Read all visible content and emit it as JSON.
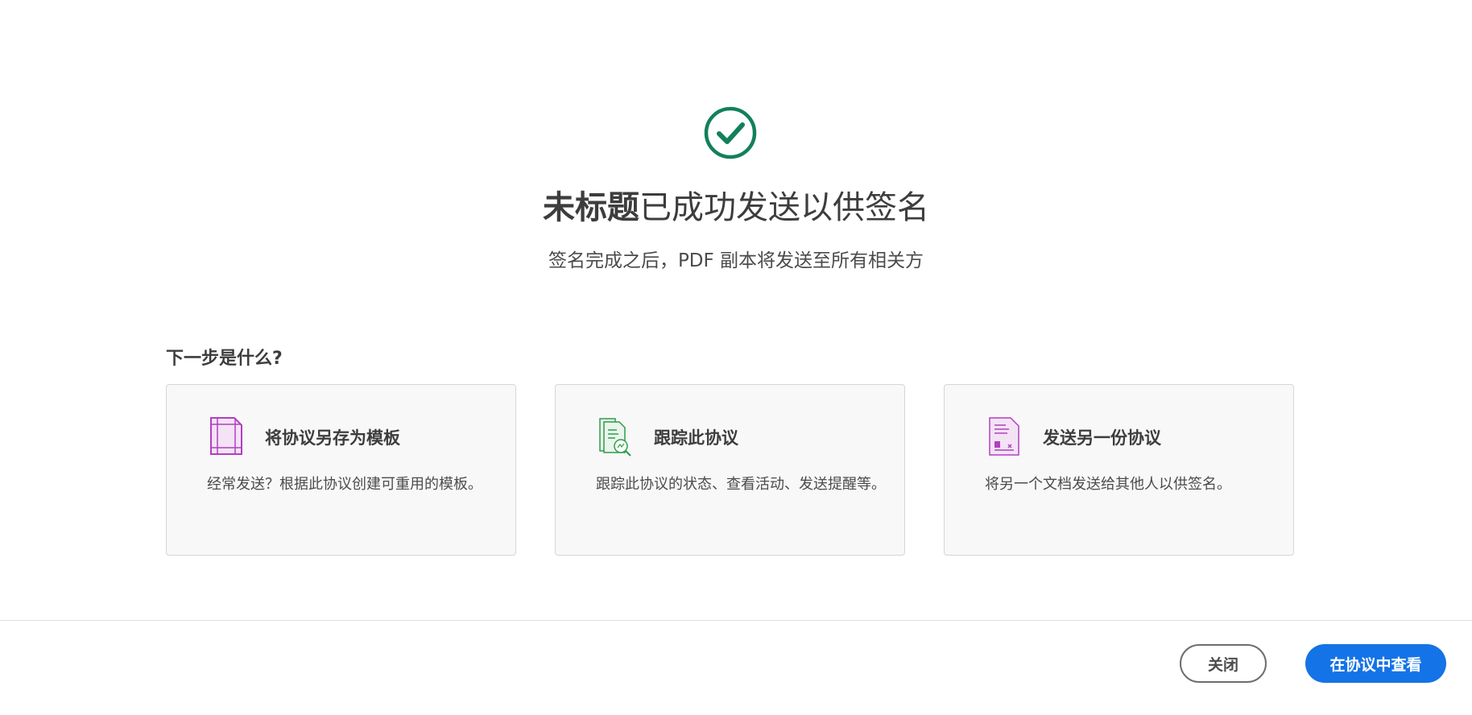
{
  "header": {
    "title_bold": "未标题",
    "title_rest": "已成功发送以供签名",
    "subtitle": "签名完成之后，PDF 副本将发送至所有相关方",
    "success_color": "#12805c"
  },
  "next_steps": {
    "heading": "下一步是什么?",
    "cards": [
      {
        "icon": "template-icon",
        "title": "将协议另存为模板",
        "description": "经常发送？根据此协议创建可重用的模板。"
      },
      {
        "icon": "track-agreement-icon",
        "title": "跟踪此协议",
        "description": "跟踪此协议的状态、查看活动、发送提醒等。"
      },
      {
        "icon": "send-document-icon",
        "title": "发送另一份协议",
        "description": "将另一个文档发送给其他人以供签名。"
      }
    ]
  },
  "footer": {
    "close_label": "关闭",
    "view_label": "在协议中查看",
    "primary_color": "#1473e6"
  }
}
